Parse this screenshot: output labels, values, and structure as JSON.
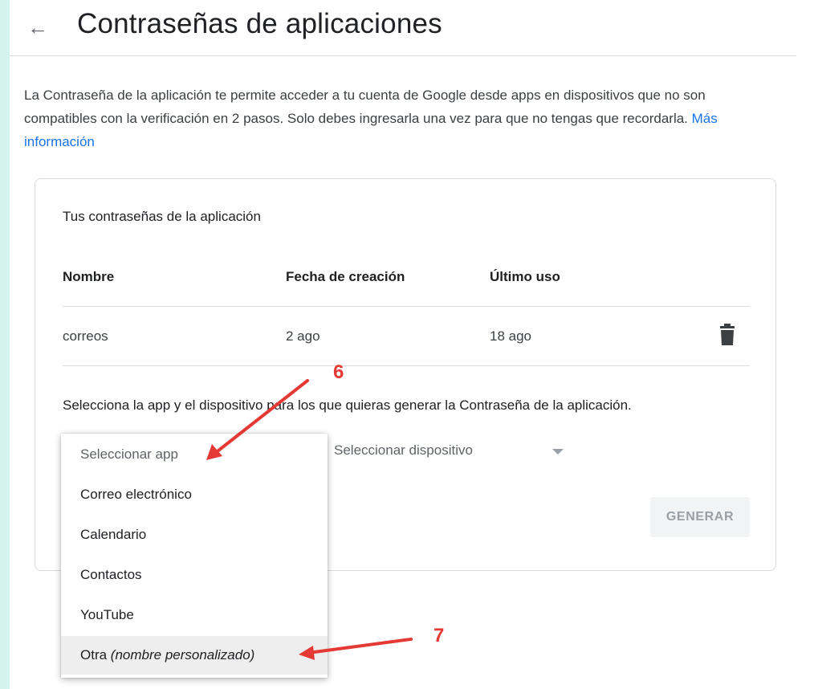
{
  "header": {
    "title": "Contraseñas de aplicaciones",
    "back_icon": "arrow-left-icon"
  },
  "intro": {
    "text": "La Contraseña de la aplicación te permite acceder a tu cuenta de Google desde apps en dispositivos que no son compatibles con la verificación en 2 pasos. Solo debes ingresarla una vez para que no tengas que recordarla.",
    "link": "Más información"
  },
  "card": {
    "title": "Tus contraseñas de la aplicación",
    "columns": [
      "Nombre",
      "Fecha de creación",
      "Último uso"
    ],
    "rows": [
      {
        "name": "correos",
        "created": "2 ago",
        "last_used": "18 ago",
        "delete_icon": "trash-icon"
      }
    ],
    "select_instructions": "Selecciona la app y el dispositivo para los que quieras generar la Contraseña de la aplicación.",
    "device_select_placeholder": "Seleccionar dispositivo",
    "generate_label": "GENERAR"
  },
  "app_dropdown": {
    "placeholder": "Seleccionar app",
    "options": [
      "Correo electrónico",
      "Calendario",
      "Contactos",
      "YouTube"
    ],
    "other_prefix": "Otra",
    "other_suffix": "(nombre personalizado)"
  },
  "annotations": {
    "step6": "6",
    "step7": "7",
    "color": "#e53935"
  },
  "colors": {
    "background": "#d4f3ec",
    "link": "#1a73e8"
  }
}
